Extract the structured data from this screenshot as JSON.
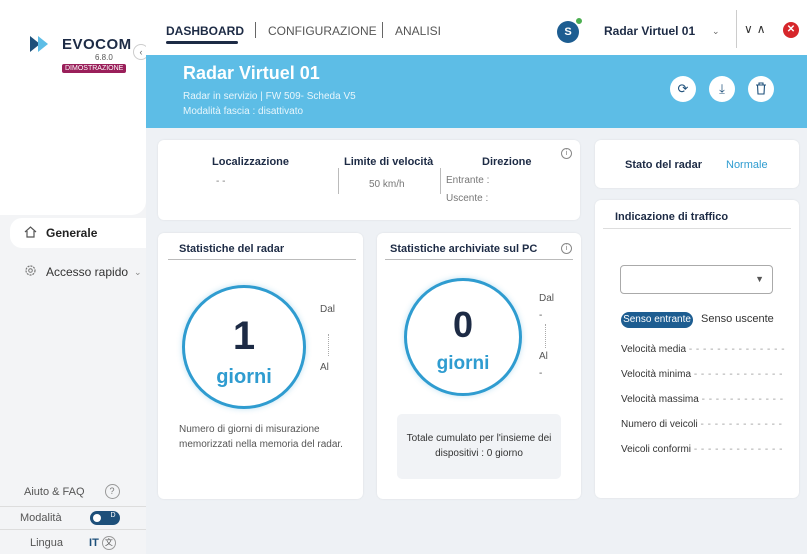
{
  "app": {
    "brand": "EVOCOM",
    "version": "6.8.0",
    "mode_badge": "DIMOSTRAZIONE"
  },
  "sidebar": {
    "items": [
      {
        "label": "Generale",
        "icon": "home-icon",
        "active": true
      },
      {
        "label": "Accesso rapido",
        "icon": "settings-icon",
        "expandable": true
      }
    ],
    "footer": {
      "help_label": "Aiuto & FAQ",
      "mode_label": "Modalità",
      "mode_toggle": "D",
      "language_label": "Lingua",
      "language_code": "IT"
    }
  },
  "topbar": {
    "tabs": [
      "DASHBOARD",
      "CONFIGURAZIONE",
      "ANALISI"
    ],
    "active_tab": "DASHBOARD",
    "user_initial": "S",
    "radar_selected": "Radar Virtuel 01"
  },
  "banner": {
    "title": "Radar Virtuel 01",
    "status_line": "Radar in servizio | FW 509- Scheda V5",
    "mode_line": "Modalità fascia : disattivato",
    "actions": [
      "sync-icon",
      "download-icon",
      "trash-icon"
    ]
  },
  "info_card": {
    "location_label": "Localizzazione",
    "location_value": "- -",
    "speed_limit_label": "Limite di velocità",
    "speed_limit_value": "50 km/h",
    "direction_label": "Direzione",
    "direction_in": "Entrante :",
    "direction_out": "Uscente :"
  },
  "radar_state": {
    "label": "Stato del radar",
    "value": "Normale"
  },
  "radar_stats": {
    "title": "Statistiche del radar",
    "count": "1",
    "unit": "giorni",
    "from_label": "Dal",
    "to_label": "Al",
    "description": "Numero di giorni di misurazione memorizzati nella memoria del radar."
  },
  "pc_stats": {
    "title": "Statistiche archiviate sul PC",
    "count": "0",
    "unit": "giorni",
    "from_label": "Dal",
    "from_value": "-",
    "to_label": "Al",
    "to_value": "-",
    "total": "Totale cumulato per l'insieme dei dispositivi : 0 giorno"
  },
  "traffic": {
    "title": "Indicazione di traffico",
    "select_value": "",
    "direction_tabs": [
      "Senso entrante",
      "Senso uscente"
    ],
    "metrics": [
      "Velocità media",
      "Velocità minima",
      "Velocità massima",
      "Numero di veicoli",
      "Veicoli conformi"
    ]
  },
  "colors": {
    "accent": "#5dbde6",
    "brand_dark": "#1d2b45",
    "ring": "#2f9cd0",
    "close": "#d6262b"
  }
}
